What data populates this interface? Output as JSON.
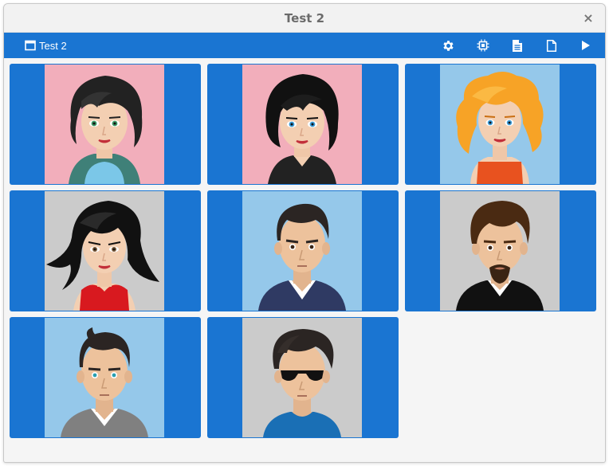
{
  "window": {
    "title": "Test 2",
    "close_glyph": "×"
  },
  "toolbar": {
    "tab_label": "Test 2",
    "tab_icon": "window-icon",
    "actions": [
      {
        "name": "settings-button",
        "icon": "gear-icon"
      },
      {
        "name": "cpu-button",
        "icon": "chip-icon"
      },
      {
        "name": "document-button",
        "icon": "document-lines-icon"
      },
      {
        "name": "new-file-button",
        "icon": "blank-file-icon"
      },
      {
        "name": "play-button",
        "icon": "play-icon"
      }
    ]
  },
  "colors": {
    "accent": "#1a75d2",
    "window_bg": "#f5f5f5",
    "pink": "#f2aebb",
    "light_blue": "#95c8ea",
    "grey": "#cbcbcb"
  },
  "participants": [
    {
      "id": 1,
      "avatar": "woman-short-dark-hair-green-eyes",
      "bg": "pink"
    },
    {
      "id": 2,
      "avatar": "woman-black-bob-hair",
      "bg": "pink"
    },
    {
      "id": 3,
      "avatar": "woman-orange-curly-hair",
      "bg": "light_blue"
    },
    {
      "id": 4,
      "avatar": "woman-long-black-hair-red-top",
      "bg": "grey"
    },
    {
      "id": 5,
      "avatar": "man-dark-hair-navy-sweater",
      "bg": "light_blue"
    },
    {
      "id": 6,
      "avatar": "man-brown-hair-goatee",
      "bg": "grey"
    },
    {
      "id": 7,
      "avatar": "man-short-hair-grey-sweater",
      "bg": "light_blue"
    },
    {
      "id": 8,
      "avatar": "man-sunglasses-blue-shirt",
      "bg": "grey"
    }
  ]
}
